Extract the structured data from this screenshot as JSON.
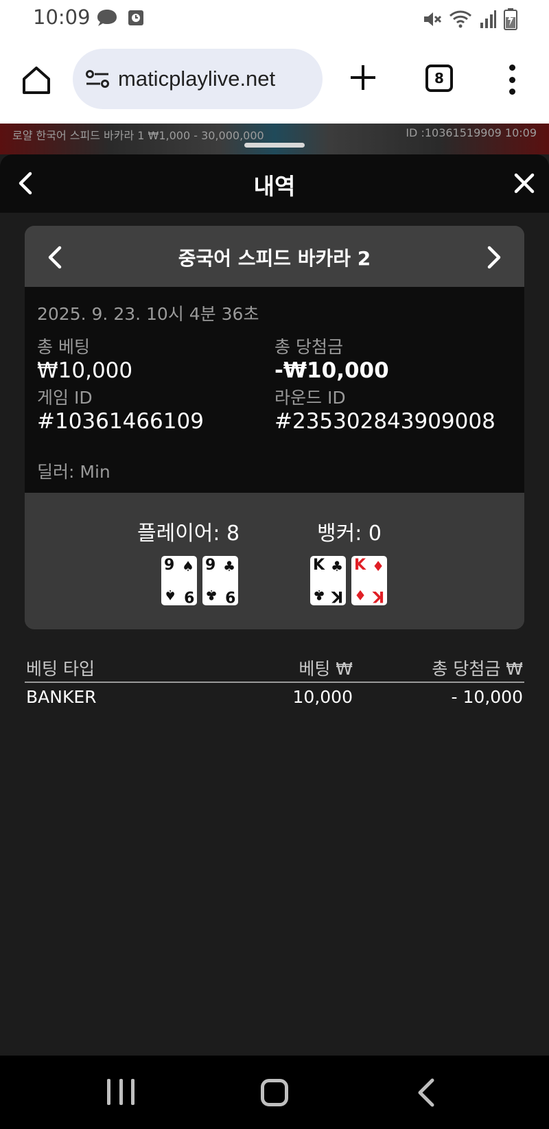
{
  "status_bar": {
    "time": "10:09",
    "left_icons": [
      "chat-bubble-icon",
      "clock-icon"
    ],
    "right_icons": [
      "mute-icon",
      "wifi-icon",
      "signal-icon",
      "battery-icon"
    ]
  },
  "browser": {
    "url": "maticplaylive.net",
    "tab_count": "8"
  },
  "game_strip": {
    "left_text": "로얄 한국어 스피드 바카라 1 ₩1,000 - 30,000,000",
    "right_text": "ID :10361519909 10:09"
  },
  "sheet": {
    "title": "내역"
  },
  "card": {
    "game_name": "중국어 스피드 바카라 2",
    "datetime": "2025. 9. 23. 10시 4분 36초",
    "total_bet_label": "총 베팅",
    "total_bet_value": "₩10,000",
    "total_win_label": "총 당첨금",
    "total_win_value": "-₩10,000",
    "game_id_label": "게임 ID",
    "game_id_value": "#10361466109",
    "round_id_label": "라운드 ID",
    "round_id_value": "#235302843909008",
    "dealer": "딜러: Min",
    "player_score": "플레이어: 8",
    "banker_score": "뱅커: 0",
    "player_cards": [
      {
        "rank": "9",
        "suit": "♠",
        "color": "#111111"
      },
      {
        "rank": "9",
        "suit": "♣",
        "color": "#111111"
      }
    ],
    "banker_cards": [
      {
        "rank": "K",
        "suit": "♣",
        "color": "#111111"
      },
      {
        "rank": "K",
        "suit": "♦",
        "color": "#e01f26"
      }
    ]
  },
  "bets": {
    "headers": {
      "type": "베팅 타입",
      "bet": "베팅 ₩",
      "win": "총 당첨금 ₩"
    },
    "rows": [
      {
        "type": "BANKER",
        "bet": "10,000",
        "win": "- 10,000"
      }
    ]
  },
  "nav": [
    "recent-apps",
    "home",
    "back"
  ]
}
